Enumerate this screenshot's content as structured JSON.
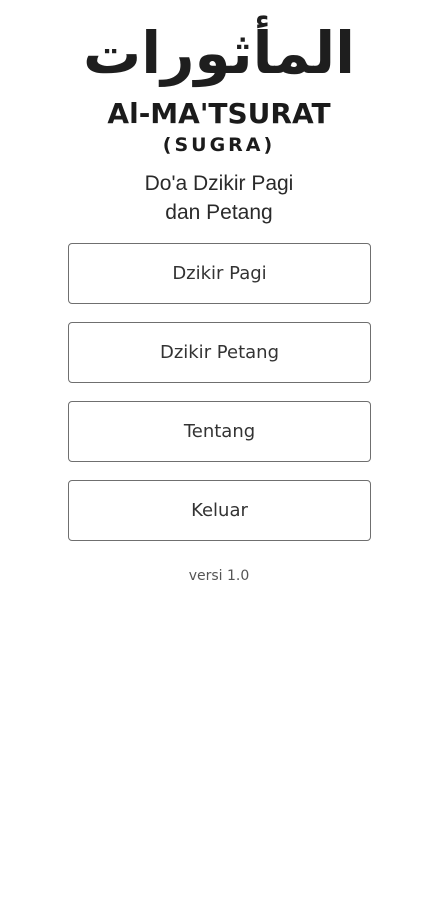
{
  "app": {
    "logo_text": "المأثورات",
    "title": "Al-MA'TSURAT",
    "subtitle": "(SUGRA)",
    "tagline_line1": "Do'a Dzikir Pagi",
    "tagline_line2": "dan Petang"
  },
  "menu": {
    "items": [
      {
        "label": "Dzikir Pagi"
      },
      {
        "label": "Dzikir Petang"
      },
      {
        "label": "Tentang"
      },
      {
        "label": "Keluar"
      }
    ]
  },
  "footer": {
    "version": "versi 1.0"
  }
}
